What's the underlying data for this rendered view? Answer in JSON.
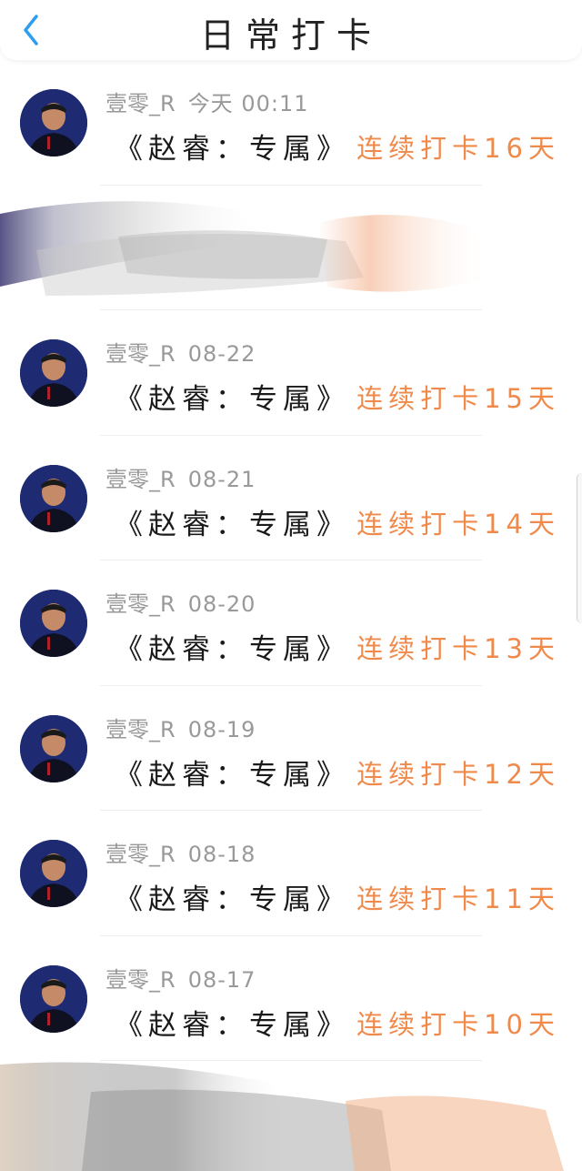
{
  "header": {
    "title": "日常打卡"
  },
  "rows": [
    {
      "user": "壹零_R",
      "date": "今天 00:11",
      "name": "《赵睿：专属》",
      "streak": "连续打卡16天"
    },
    {
      "user": "",
      "date": "",
      "name": "",
      "streak": ""
    },
    {
      "user": "壹零_R",
      "date": "08-22",
      "name": "《赵睿：专属》",
      "streak": "连续打卡15天"
    },
    {
      "user": "壹零_R",
      "date": "08-21",
      "name": "《赵睿：专属》",
      "streak": "连续打卡14天"
    },
    {
      "user": "壹零_R",
      "date": "08-20",
      "name": "《赵睿：专属》",
      "streak": "连续打卡13天"
    },
    {
      "user": "壹零_R",
      "date": "08-19",
      "name": "《赵睿：专属》",
      "streak": "连续打卡12天"
    },
    {
      "user": "壹零_R",
      "date": "08-18",
      "name": "《赵睿：专属》",
      "streak": "连续打卡11天"
    },
    {
      "user": "壹零_R",
      "date": "08-17",
      "name": "《赵睿：专属》",
      "streak": "连续打卡10天"
    },
    {
      "user": "",
      "date": "",
      "name": "",
      "streak": ""
    }
  ],
  "colors": {
    "accent": "#f08a4b",
    "muted": "#999999",
    "back": "#2f9ef0"
  }
}
